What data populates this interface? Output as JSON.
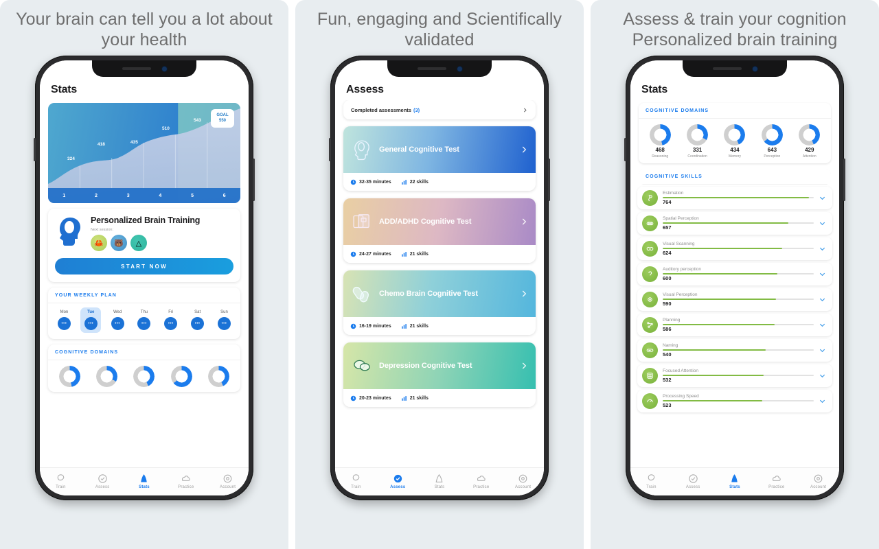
{
  "panels": [
    {
      "headline": "Your brain can tell you a lot about your health",
      "app_title": "Stats",
      "active_tab": "Stats"
    },
    {
      "headline": "Fun, engaging and Scientifically validated",
      "app_title": "Assess",
      "active_tab": "Assess"
    },
    {
      "headline": "Assess & train your cognition Personalized brain training",
      "app_title": "Stats",
      "active_tab": "Stats"
    }
  ],
  "tabs": [
    {
      "label": "Train",
      "icon": "brain-icon"
    },
    {
      "label": "Assess",
      "icon": "check-circle-icon"
    },
    {
      "label": "Stats",
      "icon": "chart-bell-icon"
    },
    {
      "label": "Practice",
      "icon": "cloud-icon"
    },
    {
      "label": "Account",
      "icon": "gear-icon"
    }
  ],
  "chart_data": {
    "type": "area",
    "title": "",
    "categories": [
      "1",
      "2",
      "3",
      "4",
      "5",
      "6"
    ],
    "values": [
      324,
      418,
      435,
      510,
      543,
      550
    ],
    "point_labels": [
      "324",
      "418",
      "435",
      "510",
      "543"
    ],
    "goal_label": "GOAL",
    "goal_value": "550",
    "xlabel": "",
    "ylabel": "",
    "ylim": [
      0,
      600
    ],
    "grid": true,
    "legend": "none"
  },
  "pbt": {
    "title": "Personalized Brain Training",
    "subtitle": "Next session:",
    "start_label": "START NOW",
    "game_icons": [
      "game-icon-orange",
      "game-icon-bear",
      "game-icon-shapes"
    ]
  },
  "weekly_plan": {
    "heading": "YOUR WEEKLY PLAN",
    "days": [
      "Mon",
      "Tue",
      "Wed",
      "Thu",
      "Fri",
      "Sat",
      "Sun"
    ],
    "selected": "Tue",
    "dot_label": "•••"
  },
  "cognitive_domains": {
    "heading": "COGNITIVE DOMAINS",
    "items": [
      {
        "label": "Reasoning",
        "value": "468",
        "percent": 47
      },
      {
        "label": "Coordination",
        "value": "331",
        "percent": 33
      },
      {
        "label": "Memory",
        "value": "434",
        "percent": 43
      },
      {
        "label": "Perception",
        "value": "643",
        "percent": 64
      },
      {
        "label": "Attention",
        "value": "429",
        "percent": 43
      }
    ]
  },
  "assess": {
    "completed_label": "Completed assessments",
    "completed_count": "(3)",
    "tests": [
      {
        "name": "General Cognitive Test",
        "duration": "32-35 minutes",
        "skills": "22 skills",
        "icon": "brain-head-icon",
        "gradient": "linear-gradient(100deg,#bfe4dd 0%,#7fb6e2 45%,#1f61cf 100%)"
      },
      {
        "name": "ADD/ADHD Cognitive Test",
        "duration": "24-27 minutes",
        "skills": "21 skills",
        "icon": "cards-icon",
        "gradient": "linear-gradient(100deg,#e9cfa3 0%,#ddb8c4 50%,#a98ac6 100%)"
      },
      {
        "name": "Chemo Brain Cognitive Test",
        "duration": "16-19 minutes",
        "skills": "21 skills",
        "icon": "pills-icon",
        "gradient": "linear-gradient(100deg,#d8e3b4 0%,#8fd0d9 45%,#54b6dd 100%)"
      },
      {
        "name": "Depression Cognitive Test",
        "duration": "20-23 minutes",
        "skills": "21 skills",
        "icon": "clouds-icon",
        "gradient": "linear-gradient(100deg,#d6e6a8 0%,#8fd4b6 50%,#36bfb0 100%)"
      }
    ],
    "clock_icon": "clock-icon",
    "bars_icon": "bar-chart-icon",
    "chevron_icon": "chevron-right-icon"
  },
  "cognitive_skills": {
    "heading": "COGNITIVE SKILLS",
    "items": [
      {
        "name": "Estimation",
        "value": "764",
        "percent": 97,
        "icon": "estimation-icon"
      },
      {
        "name": "Spatial Perception",
        "value": "657",
        "percent": 83,
        "icon": "spatial-icon"
      },
      {
        "name": "Visual Scanning",
        "value": "624",
        "percent": 79,
        "icon": "scanning-icon"
      },
      {
        "name": "Auditory perception",
        "value": "600",
        "percent": 76,
        "icon": "auditory-icon"
      },
      {
        "name": "Visual Perception",
        "value": "590",
        "percent": 75,
        "icon": "visual-icon"
      },
      {
        "name": "Planning",
        "value": "586",
        "percent": 74,
        "icon": "planning-icon"
      },
      {
        "name": "Naming",
        "value": "540",
        "percent": 68,
        "icon": "naming-icon"
      },
      {
        "name": "Focused Attention",
        "value": "532",
        "percent": 67,
        "icon": "attention-icon"
      },
      {
        "name": "Processing Speed",
        "value": "523",
        "percent": 66,
        "icon": "speed-icon"
      }
    ],
    "chevron_icon": "chevron-down-icon"
  },
  "colors": {
    "accent_blue": "#1b7ced",
    "skill_green": "#82bb44",
    "panel_bg": "#e8edf0",
    "headline_gray": "#6e6e6e"
  }
}
